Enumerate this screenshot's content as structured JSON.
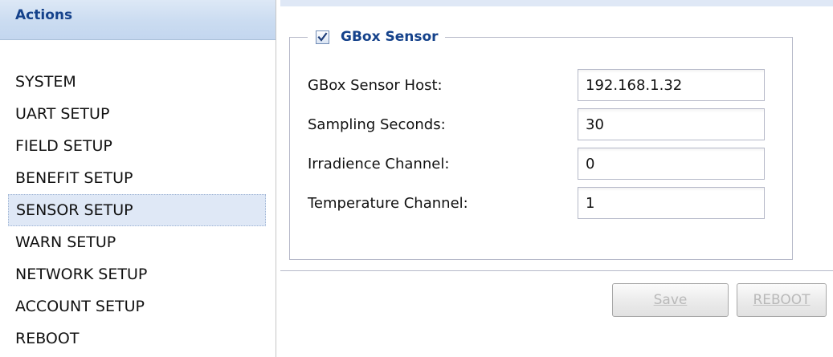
{
  "sidebar": {
    "title": "Actions",
    "items": [
      {
        "label": "SYSTEM",
        "selected": false
      },
      {
        "label": "UART SETUP",
        "selected": false
      },
      {
        "label": "FIELD SETUP",
        "selected": false
      },
      {
        "label": "BENEFIT SETUP",
        "selected": false
      },
      {
        "label": "SENSOR SETUP",
        "selected": true
      },
      {
        "label": "WARN SETUP",
        "selected": false
      },
      {
        "label": "NETWORK SETUP",
        "selected": false
      },
      {
        "label": "ACCOUNT SETUP",
        "selected": false
      },
      {
        "label": "REBOOT",
        "selected": false
      }
    ]
  },
  "form": {
    "fieldset_label": "GBox Sensor",
    "fieldset_checked": true,
    "fields": [
      {
        "label": "GBox Sensor Host:",
        "value": "192.168.1.32"
      },
      {
        "label": "Sampling Seconds:",
        "value": "30"
      },
      {
        "label": "Irradience Channel:",
        "value": "0"
      },
      {
        "label": "Temperature Channel:",
        "value": "1"
      }
    ]
  },
  "buttons": {
    "save_label": "Save",
    "reboot_label": "REBOOT"
  },
  "colors": {
    "header_text": "#15428b",
    "selected_bg": "#dfe8f6",
    "disabled_button_text": "#b9b9b9"
  },
  "icons": {
    "checkbox": "checkmark-icon"
  }
}
